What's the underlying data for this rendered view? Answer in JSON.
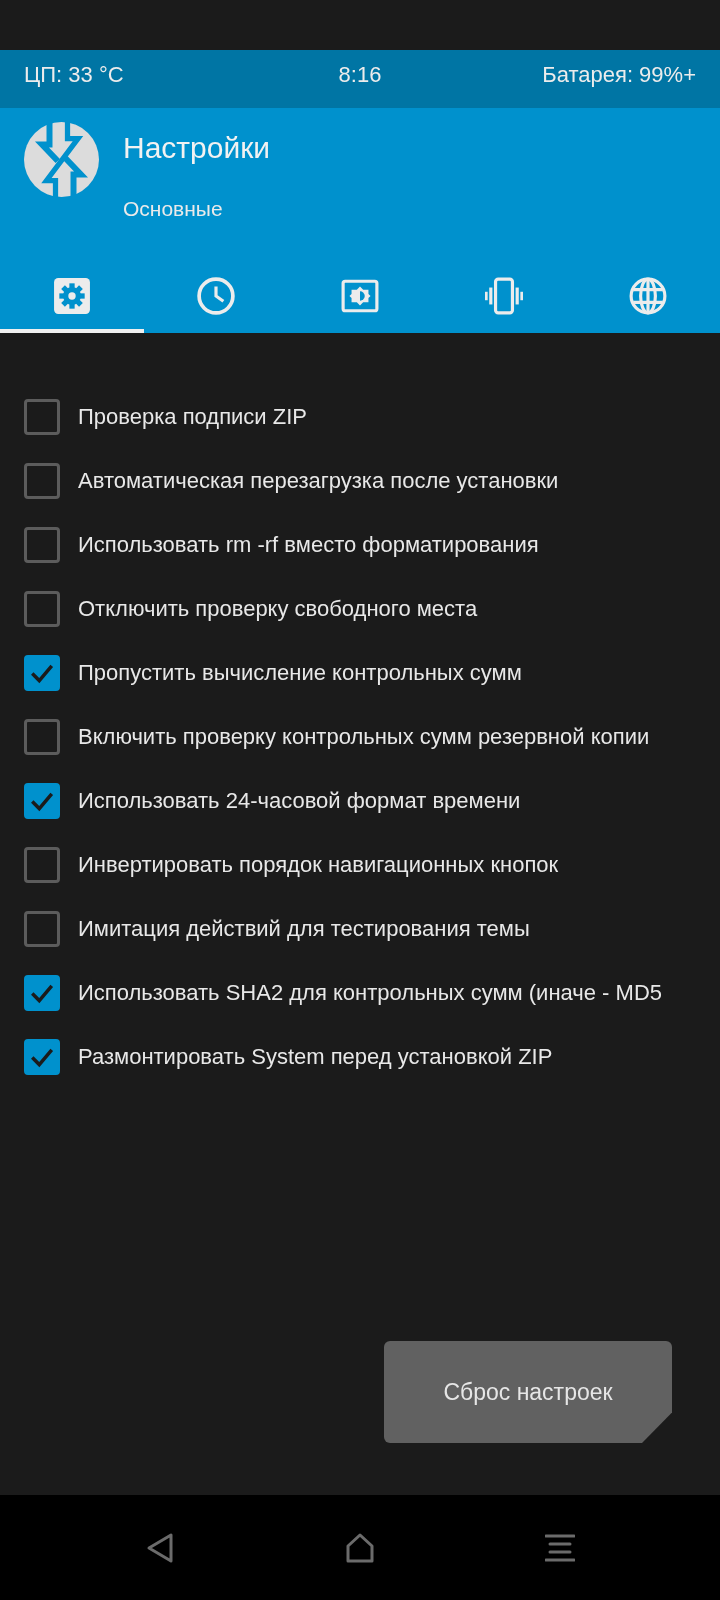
{
  "status_bar": {
    "cpu": "ЦП: 33 °C",
    "time": "8:16",
    "battery": "Батарея: 99%+"
  },
  "header": {
    "title": "Настройки",
    "subtitle": "Основные"
  },
  "tabs": [
    {
      "kind": "general",
      "selected": true
    },
    {
      "kind": "time",
      "selected": false
    },
    {
      "kind": "screen",
      "selected": false
    },
    {
      "kind": "vibration",
      "selected": false
    },
    {
      "kind": "language",
      "selected": false
    }
  ],
  "options": [
    {
      "label": "Проверка подписи ZIP",
      "checked": false
    },
    {
      "label": "Автоматическая перезагрузка после установки",
      "checked": false
    },
    {
      "label": "Использовать rm -rf вместо форматирования",
      "checked": false
    },
    {
      "label": "Отключить проверку свободного места",
      "checked": false
    },
    {
      "label": "Пропустить вычисление контрольных сумм",
      "checked": true
    },
    {
      "label": "Включить проверку контрольных сумм резервной копии",
      "checked": false
    },
    {
      "label": "Использовать 24-часовой формат времени",
      "checked": true
    },
    {
      "label": "Инвертировать порядок навигационных кнопок",
      "checked": false
    },
    {
      "label": "Имитация действий для тестирования темы",
      "checked": false
    },
    {
      "label": "Использовать SHA2 для контрольных сумм (иначе - MD5",
      "checked": true
    },
    {
      "label": "Размонтировать System перед установкой ZIP",
      "checked": true
    }
  ],
  "reset_button": {
    "label": "Сброс настроек"
  }
}
